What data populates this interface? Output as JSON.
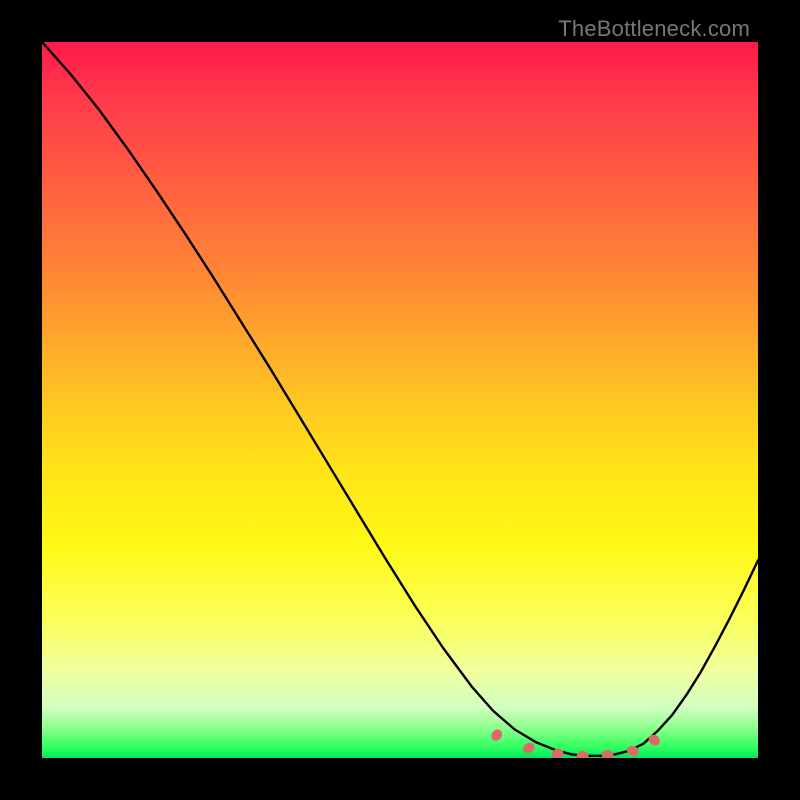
{
  "watermark": "TheBottleneck.com",
  "chart_data": {
    "type": "line",
    "title": "",
    "xlabel": "",
    "ylabel": "",
    "xlim": [
      0,
      100
    ],
    "ylim": [
      0,
      100
    ],
    "series": [
      {
        "name": "bottleneck-curve",
        "x": [
          0,
          4,
          8,
          12,
          16,
          20,
          24,
          28,
          32,
          36,
          40,
          44,
          48,
          52,
          56,
          60,
          63,
          66,
          69,
          72,
          74,
          76,
          78,
          80,
          82,
          84,
          86,
          88,
          90,
          92,
          94,
          96,
          98,
          100
        ],
        "y": [
          100,
          95.5,
          90.5,
          85.0,
          79.2,
          73.2,
          67.0,
          60.6,
          54.2,
          47.6,
          41.0,
          34.4,
          27.8,
          21.4,
          15.4,
          10.0,
          6.6,
          4.0,
          2.2,
          1.0,
          0.5,
          0.3,
          0.3,
          0.5,
          1.0,
          2.0,
          3.8,
          6.0,
          8.8,
          12.0,
          15.6,
          19.4,
          23.4,
          27.6
        ]
      }
    ],
    "markers": {
      "name": "highlight-dots",
      "color": "#dd6b63",
      "points": [
        {
          "x": 63.5,
          "y": 3.2,
          "rx": 6,
          "ry": 5,
          "rot": -55
        },
        {
          "x": 68.0,
          "y": 1.4,
          "rx": 6,
          "ry": 5,
          "rot": -30
        },
        {
          "x": 72.0,
          "y": 0.6,
          "rx": 6,
          "ry": 5,
          "rot": -10
        },
        {
          "x": 75.5,
          "y": 0.3,
          "rx": 6,
          "ry": 5,
          "rot": 0
        },
        {
          "x": 79.0,
          "y": 0.4,
          "rx": 6,
          "ry": 5,
          "rot": 10
        },
        {
          "x": 82.5,
          "y": 1.0,
          "rx": 6,
          "ry": 5,
          "rot": 20
        },
        {
          "x": 85.5,
          "y": 2.5,
          "rx": 6,
          "ry": 5,
          "rot": 40
        }
      ]
    }
  }
}
